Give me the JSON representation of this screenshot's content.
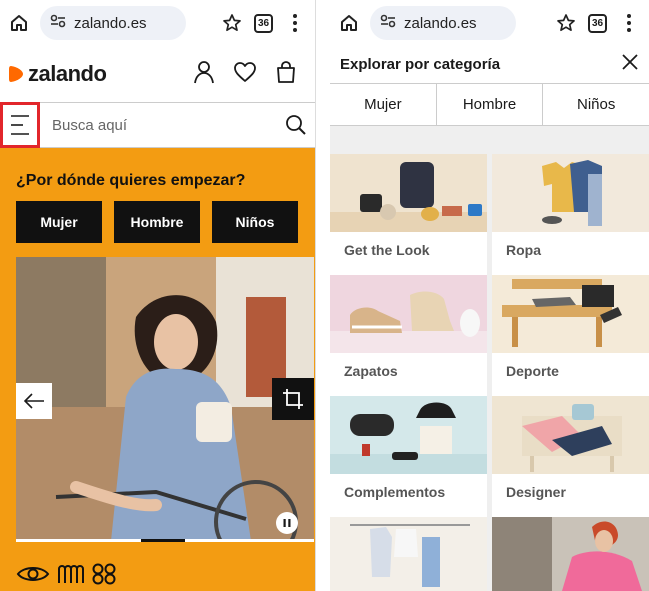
{
  "left": {
    "browser": {
      "url": "zalando.es",
      "tab_count": "36"
    },
    "brand": {
      "name": "zalando",
      "accent": "#ff6900"
    },
    "search": {
      "placeholder": "Busca aquí"
    },
    "promo": {
      "heading": "¿Por dónde quieres empezar?",
      "buttons": [
        "Mujer",
        "Hombre",
        "Niños"
      ],
      "background": "#f39c12",
      "carousel_progress": 0.42
    }
  },
  "right": {
    "browser": {
      "url": "zalando.es",
      "tab_count": "36"
    },
    "panel_title": "Explorar por categoría",
    "tabs": [
      "Mujer",
      "Hombre",
      "Niños"
    ],
    "categories": [
      {
        "label": "Get the Look"
      },
      {
        "label": "Ropa"
      },
      {
        "label": "Zapatos"
      },
      {
        "label": "Deporte"
      },
      {
        "label": "Complementos"
      },
      {
        "label": "Designer"
      }
    ]
  }
}
